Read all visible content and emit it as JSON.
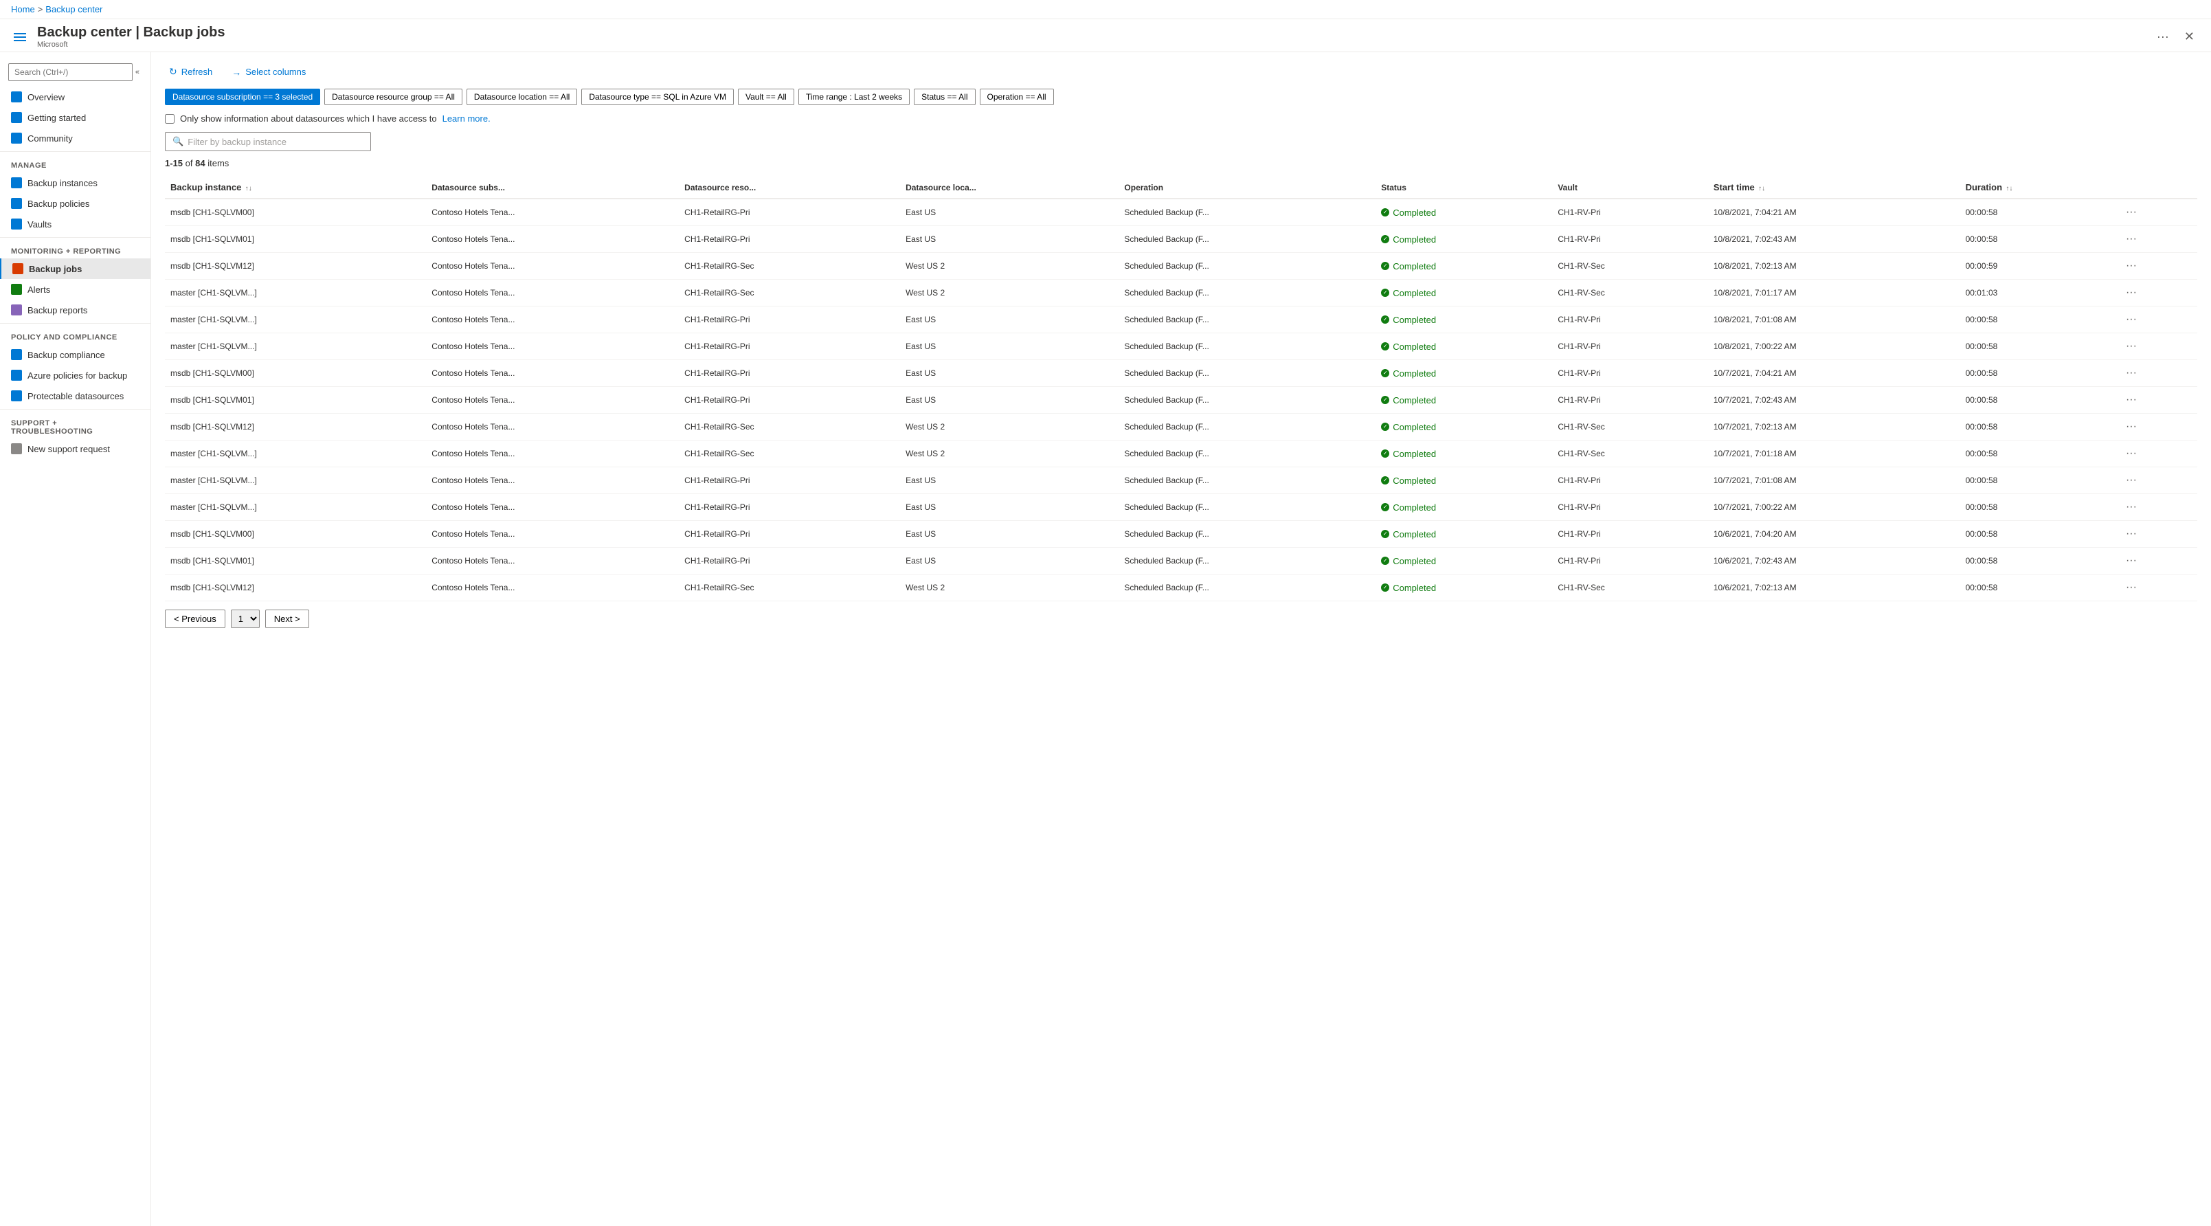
{
  "breadcrumb": {
    "home": "Home",
    "separator": ">",
    "current": "Backup center"
  },
  "header": {
    "icon": "≡",
    "title": "Backup center | Backup jobs",
    "subtitle": "Microsoft",
    "ellipsis": "···",
    "close": "✕"
  },
  "sidebar": {
    "search_placeholder": "Search (Ctrl+/)",
    "collapse_label": "«",
    "items": [
      {
        "id": "overview",
        "label": "Overview",
        "icon": "overview"
      },
      {
        "id": "getting-started",
        "label": "Getting started",
        "icon": "getting-started"
      },
      {
        "id": "community",
        "label": "Community",
        "icon": "community"
      }
    ],
    "sections": [
      {
        "label": "Manage",
        "items": [
          {
            "id": "backup-instances",
            "label": "Backup instances",
            "icon": "instances"
          },
          {
            "id": "backup-policies",
            "label": "Backup policies",
            "icon": "policies"
          },
          {
            "id": "vaults",
            "label": "Vaults",
            "icon": "vaults"
          }
        ]
      },
      {
        "label": "Monitoring + reporting",
        "items": [
          {
            "id": "backup-jobs",
            "label": "Backup jobs",
            "icon": "jobs",
            "active": true
          },
          {
            "id": "alerts",
            "label": "Alerts",
            "icon": "alerts"
          },
          {
            "id": "backup-reports",
            "label": "Backup reports",
            "icon": "reports"
          }
        ]
      },
      {
        "label": "Policy and compliance",
        "items": [
          {
            "id": "backup-compliance",
            "label": "Backup compliance",
            "icon": "compliance"
          },
          {
            "id": "azure-policies",
            "label": "Azure policies for backup",
            "icon": "azure-policies"
          },
          {
            "id": "protectable-datasources",
            "label": "Protectable datasources",
            "icon": "datasources"
          }
        ]
      },
      {
        "label": "Support + troubleshooting",
        "items": [
          {
            "id": "new-support",
            "label": "New support request",
            "icon": "support"
          }
        ]
      }
    ]
  },
  "toolbar": {
    "refresh_label": "Refresh",
    "select_columns_label": "Select columns"
  },
  "filters": [
    {
      "id": "subscription",
      "label": "Datasource subscription == 3 selected",
      "active": true
    },
    {
      "id": "resource-group",
      "label": "Datasource resource group == All",
      "active": false
    },
    {
      "id": "location",
      "label": "Datasource location == All",
      "active": false
    },
    {
      "id": "type",
      "label": "Datasource type == SQL in Azure VM",
      "active": false
    },
    {
      "id": "vault",
      "label": "Vault == All",
      "active": false
    },
    {
      "id": "time-range",
      "label": "Time range : Last 2 weeks",
      "active": false
    },
    {
      "id": "status",
      "label": "Status == All",
      "active": false
    },
    {
      "id": "operation",
      "label": "Operation == All",
      "active": false
    }
  ],
  "checkbox": {
    "label": "Only show information about datasources which I have access to",
    "link_text": "Learn more."
  },
  "search": {
    "placeholder": "Filter by backup instance"
  },
  "items_count": {
    "range": "1-15",
    "total": "84",
    "label": "items"
  },
  "table": {
    "columns": [
      {
        "id": "backup-instance",
        "label": "Backup instance",
        "sortable": true
      },
      {
        "id": "datasource-subs",
        "label": "Datasource subs...",
        "sortable": false
      },
      {
        "id": "datasource-reso",
        "label": "Datasource reso...",
        "sortable": false
      },
      {
        "id": "datasource-loca",
        "label": "Datasource loca...",
        "sortable": false
      },
      {
        "id": "operation",
        "label": "Operation",
        "sortable": false
      },
      {
        "id": "status",
        "label": "Status",
        "sortable": false
      },
      {
        "id": "vault",
        "label": "Vault",
        "sortable": false
      },
      {
        "id": "start-time",
        "label": "Start time",
        "sortable": true
      },
      {
        "id": "duration",
        "label": "Duration",
        "sortable": true
      },
      {
        "id": "actions",
        "label": "",
        "sortable": false
      }
    ],
    "rows": [
      {
        "backup_instance": "msdb [CH1-SQLVM00]",
        "datasource_subs": "Contoso Hotels Tena...",
        "datasource_reso": "CH1-RetailRG-Pri",
        "datasource_loca": "East US",
        "operation": "Scheduled Backup (F...",
        "status": "Completed",
        "vault": "CH1-RV-Pri",
        "start_time": "10/8/2021, 7:04:21 AM",
        "duration": "00:00:58"
      },
      {
        "backup_instance": "msdb [CH1-SQLVM01]",
        "datasource_subs": "Contoso Hotels Tena...",
        "datasource_reso": "CH1-RetailRG-Pri",
        "datasource_loca": "East US",
        "operation": "Scheduled Backup (F...",
        "status": "Completed",
        "vault": "CH1-RV-Pri",
        "start_time": "10/8/2021, 7:02:43 AM",
        "duration": "00:00:58"
      },
      {
        "backup_instance": "msdb [CH1-SQLVM12]",
        "datasource_subs": "Contoso Hotels Tena...",
        "datasource_reso": "CH1-RetailRG-Sec",
        "datasource_loca": "West US 2",
        "operation": "Scheduled Backup (F...",
        "status": "Completed",
        "vault": "CH1-RV-Sec",
        "start_time": "10/8/2021, 7:02:13 AM",
        "duration": "00:00:59"
      },
      {
        "backup_instance": "master [CH1-SQLVM...]",
        "datasource_subs": "Contoso Hotels Tena...",
        "datasource_reso": "CH1-RetailRG-Sec",
        "datasource_loca": "West US 2",
        "operation": "Scheduled Backup (F...",
        "status": "Completed",
        "vault": "CH1-RV-Sec",
        "start_time": "10/8/2021, 7:01:17 AM",
        "duration": "00:01:03"
      },
      {
        "backup_instance": "master [CH1-SQLVM...]",
        "datasource_subs": "Contoso Hotels Tena...",
        "datasource_reso": "CH1-RetailRG-Pri",
        "datasource_loca": "East US",
        "operation": "Scheduled Backup (F...",
        "status": "Completed",
        "vault": "CH1-RV-Pri",
        "start_time": "10/8/2021, 7:01:08 AM",
        "duration": "00:00:58"
      },
      {
        "backup_instance": "master [CH1-SQLVM...]",
        "datasource_subs": "Contoso Hotels Tena...",
        "datasource_reso": "CH1-RetailRG-Pri",
        "datasource_loca": "East US",
        "operation": "Scheduled Backup (F...",
        "status": "Completed",
        "vault": "CH1-RV-Pri",
        "start_time": "10/8/2021, 7:00:22 AM",
        "duration": "00:00:58"
      },
      {
        "backup_instance": "msdb [CH1-SQLVM00]",
        "datasource_subs": "Contoso Hotels Tena...",
        "datasource_reso": "CH1-RetailRG-Pri",
        "datasource_loca": "East US",
        "operation": "Scheduled Backup (F...",
        "status": "Completed",
        "vault": "CH1-RV-Pri",
        "start_time": "10/7/2021, 7:04:21 AM",
        "duration": "00:00:58"
      },
      {
        "backup_instance": "msdb [CH1-SQLVM01]",
        "datasource_subs": "Contoso Hotels Tena...",
        "datasource_reso": "CH1-RetailRG-Pri",
        "datasource_loca": "East US",
        "operation": "Scheduled Backup (F...",
        "status": "Completed",
        "vault": "CH1-RV-Pri",
        "start_time": "10/7/2021, 7:02:43 AM",
        "duration": "00:00:58"
      },
      {
        "backup_instance": "msdb [CH1-SQLVM12]",
        "datasource_subs": "Contoso Hotels Tena...",
        "datasource_reso": "CH1-RetailRG-Sec",
        "datasource_loca": "West US 2",
        "operation": "Scheduled Backup (F...",
        "status": "Completed",
        "vault": "CH1-RV-Sec",
        "start_time": "10/7/2021, 7:02:13 AM",
        "duration": "00:00:58"
      },
      {
        "backup_instance": "master [CH1-SQLVM...]",
        "datasource_subs": "Contoso Hotels Tena...",
        "datasource_reso": "CH1-RetailRG-Sec",
        "datasource_loca": "West US 2",
        "operation": "Scheduled Backup (F...",
        "status": "Completed",
        "vault": "CH1-RV-Sec",
        "start_time": "10/7/2021, 7:01:18 AM",
        "duration": "00:00:58"
      },
      {
        "backup_instance": "master [CH1-SQLVM...]",
        "datasource_subs": "Contoso Hotels Tena...",
        "datasource_reso": "CH1-RetailRG-Pri",
        "datasource_loca": "East US",
        "operation": "Scheduled Backup (F...",
        "status": "Completed",
        "vault": "CH1-RV-Pri",
        "start_time": "10/7/2021, 7:01:08 AM",
        "duration": "00:00:58"
      },
      {
        "backup_instance": "master [CH1-SQLVM...]",
        "datasource_subs": "Contoso Hotels Tena...",
        "datasource_reso": "CH1-RetailRG-Pri",
        "datasource_loca": "East US",
        "operation": "Scheduled Backup (F...",
        "status": "Completed",
        "vault": "CH1-RV-Pri",
        "start_time": "10/7/2021, 7:00:22 AM",
        "duration": "00:00:58"
      },
      {
        "backup_instance": "msdb [CH1-SQLVM00]",
        "datasource_subs": "Contoso Hotels Tena...",
        "datasource_reso": "CH1-RetailRG-Pri",
        "datasource_loca": "East US",
        "operation": "Scheduled Backup (F...",
        "status": "Completed",
        "vault": "CH1-RV-Pri",
        "start_time": "10/6/2021, 7:04:20 AM",
        "duration": "00:00:58"
      },
      {
        "backup_instance": "msdb [CH1-SQLVM01]",
        "datasource_subs": "Contoso Hotels Tena...",
        "datasource_reso": "CH1-RetailRG-Pri",
        "datasource_loca": "East US",
        "operation": "Scheduled Backup (F...",
        "status": "Completed",
        "vault": "CH1-RV-Pri",
        "start_time": "10/6/2021, 7:02:43 AM",
        "duration": "00:00:58"
      },
      {
        "backup_instance": "msdb [CH1-SQLVM12]",
        "datasource_subs": "Contoso Hotels Tena...",
        "datasource_reso": "CH1-RetailRG-Sec",
        "datasource_loca": "West US 2",
        "operation": "Scheduled Backup (F...",
        "status": "Completed",
        "vault": "CH1-RV-Sec",
        "start_time": "10/6/2021, 7:02:13 AM",
        "duration": "00:00:58"
      }
    ]
  },
  "pagination": {
    "previous_label": "< Previous",
    "next_label": "Next >",
    "current_page": "1"
  },
  "colors": {
    "accent": "#0078d4",
    "success": "#107c10",
    "border": "#edebe9",
    "active_filter_bg": "#0078d4"
  }
}
